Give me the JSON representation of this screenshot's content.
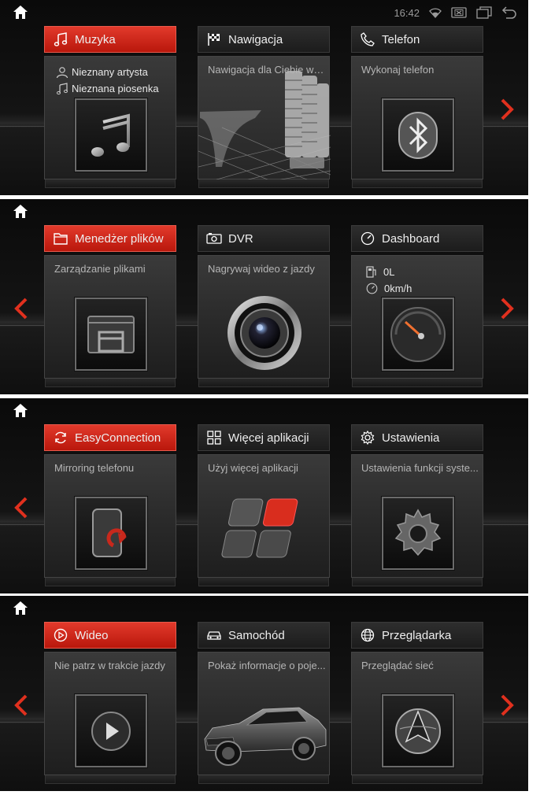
{
  "status": {
    "time": "16:42"
  },
  "panels": [
    {
      "tiles": [
        {
          "title": "Muzyka",
          "active": true,
          "artist": "Nieznany artysta",
          "song": "Nieznana piosenka"
        },
        {
          "title": "Nawigacja",
          "active": false,
          "desc": "Nawigacja dla Ciebie w c..."
        },
        {
          "title": "Telefon",
          "active": false,
          "desc": "Wykonaj telefon"
        }
      ]
    },
    {
      "tiles": [
        {
          "title": "Menedżer plików",
          "active": true,
          "desc": "Zarządzanie plikami"
        },
        {
          "title": "DVR",
          "active": false,
          "desc": "Nagrywaj wideo z jazdy"
        },
        {
          "title": "Dashboard",
          "active": false,
          "fuel": "0L",
          "speed": "0km/h"
        }
      ]
    },
    {
      "tiles": [
        {
          "title": "EasyConnection",
          "active": true,
          "desc": "Mirroring telefonu"
        },
        {
          "title": "Więcej aplikacji",
          "active": false,
          "desc": "Użyj więcej aplikacji"
        },
        {
          "title": "Ustawienia",
          "active": false,
          "desc": "Ustawienia funkcji syste..."
        }
      ]
    },
    {
      "tiles": [
        {
          "title": "Wideo",
          "active": true,
          "desc": "Nie patrz w trakcie jazdy"
        },
        {
          "title": "Samochód",
          "active": false,
          "desc": "Pokaż informacje o poje..."
        },
        {
          "title": "Przeglądarka",
          "active": false,
          "desc": "Przeglądać sieć"
        }
      ]
    }
  ],
  "colors": {
    "accent": "#d02a1c",
    "arrow": "#e0301e",
    "background": "#0c0c0c"
  }
}
